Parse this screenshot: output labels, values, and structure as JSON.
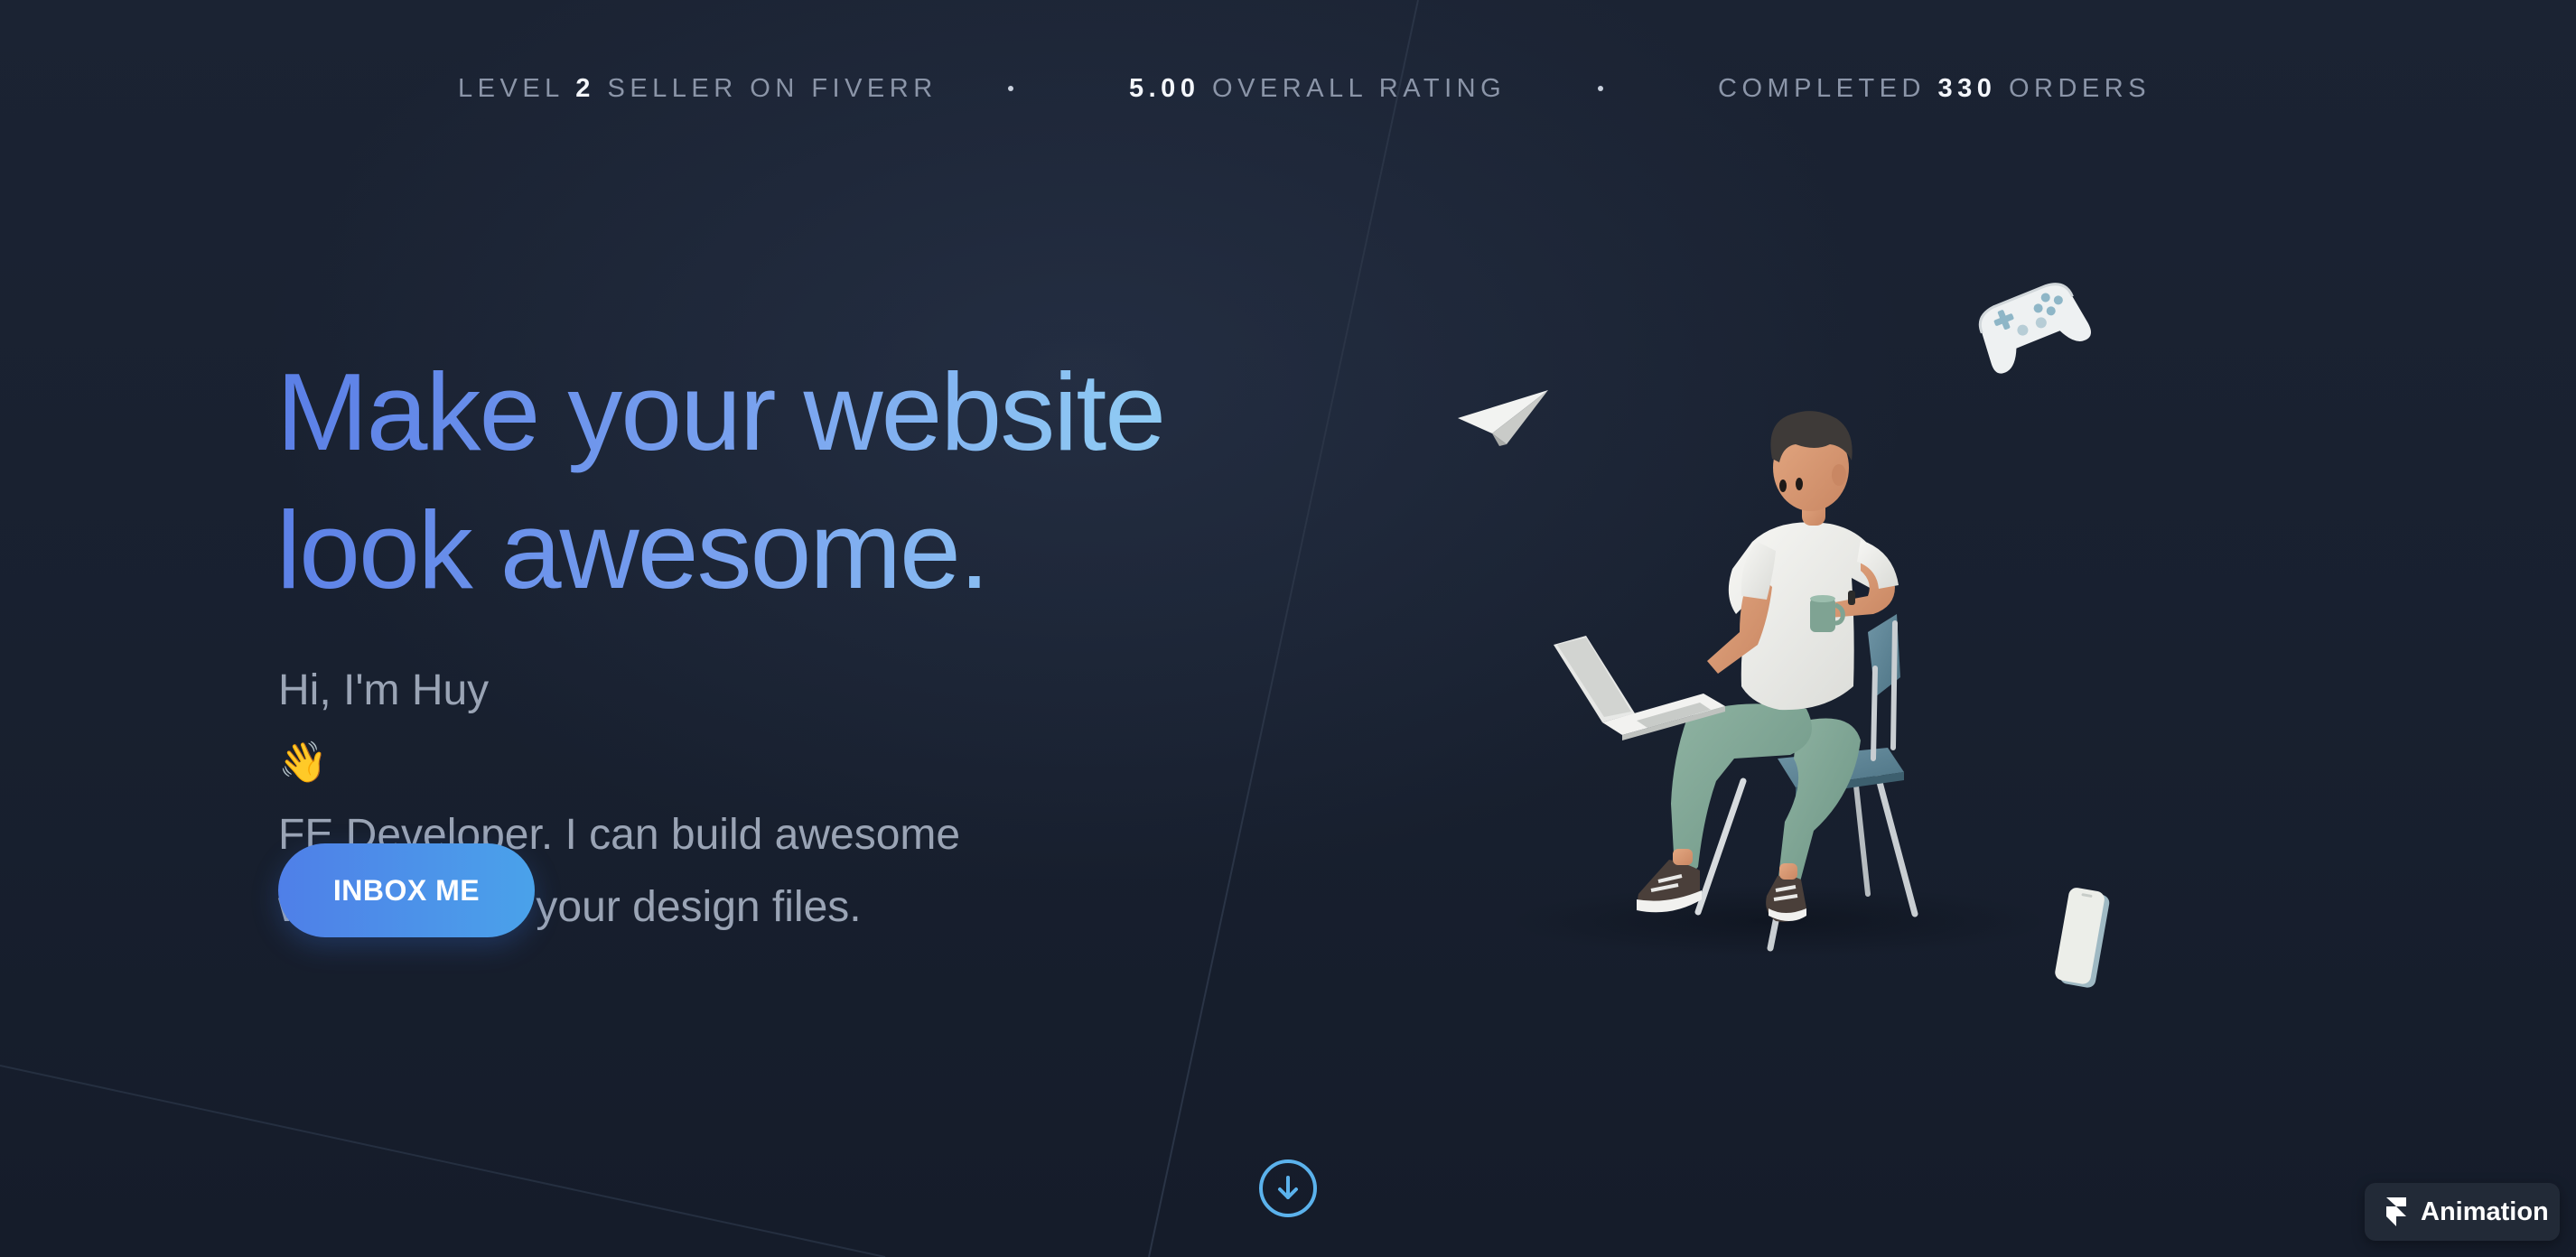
{
  "stats": [
    {
      "prefix": "LEVEL ",
      "value": "2",
      "suffix": " SELLER ON FIVERR"
    },
    {
      "prefix": "",
      "value": "5.00",
      "suffix": " OVERALL RATING"
    },
    {
      "prefix": "COMPLETED ",
      "value": "330",
      "suffix": " ORDERS"
    }
  ],
  "hero": {
    "title_line1": "Make your website",
    "title_line2": "look awesome.",
    "intro_before": "Hi, I'm Huy ",
    "wave_emoji": "👋",
    "intro_after": " FE Developer. I can build awesome",
    "intro_line2": "website from your design files.",
    "cta_label": "INBOX ME"
  },
  "badge": {
    "label": "Animation",
    "icon": "framer-icon"
  },
  "colors": {
    "background": "#18202f",
    "title_gradient_start": "#5a7ee6",
    "title_gradient_end": "#8fd0f2",
    "cta_gradient_start": "#4f7fe8",
    "cta_gradient_end": "#4aa2ea",
    "scroll_accent": "#5bb2ec",
    "muted_text": "#8b95a8"
  },
  "icons": {
    "scroll": "arrow-down-circle-icon",
    "illustration_items": [
      "paper-plane-icon",
      "game-controller-icon",
      "smartphone-icon"
    ]
  }
}
